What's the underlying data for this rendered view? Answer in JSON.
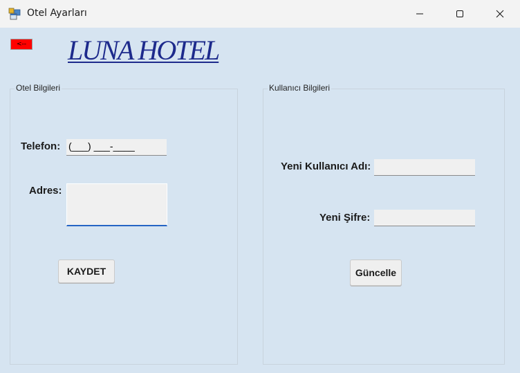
{
  "window": {
    "title": "Otel Ayarları",
    "minimize_icon": "minimize-icon",
    "maximize_icon": "maximize-icon",
    "close_icon": "close-icon"
  },
  "toolbar": {
    "back_label": "<--",
    "back_color": "#ff0000"
  },
  "logo": {
    "text": "LUNA HOTEL",
    "color": "#1d2a8c"
  },
  "hotel_info": {
    "legend": "Otel Bilgileri",
    "phone_label": "Telefon:",
    "phone_value": "(___) ___-____",
    "address_label": "Adres:",
    "address_value": "",
    "save_label": "KAYDET"
  },
  "user_info": {
    "legend": "Kullanıcı Bilgileri",
    "username_label": "Yeni Kullanıcı Adı:",
    "username_value": "",
    "password_label": "Yeni Şifre:",
    "password_value": "",
    "update_label": "Güncelle"
  }
}
